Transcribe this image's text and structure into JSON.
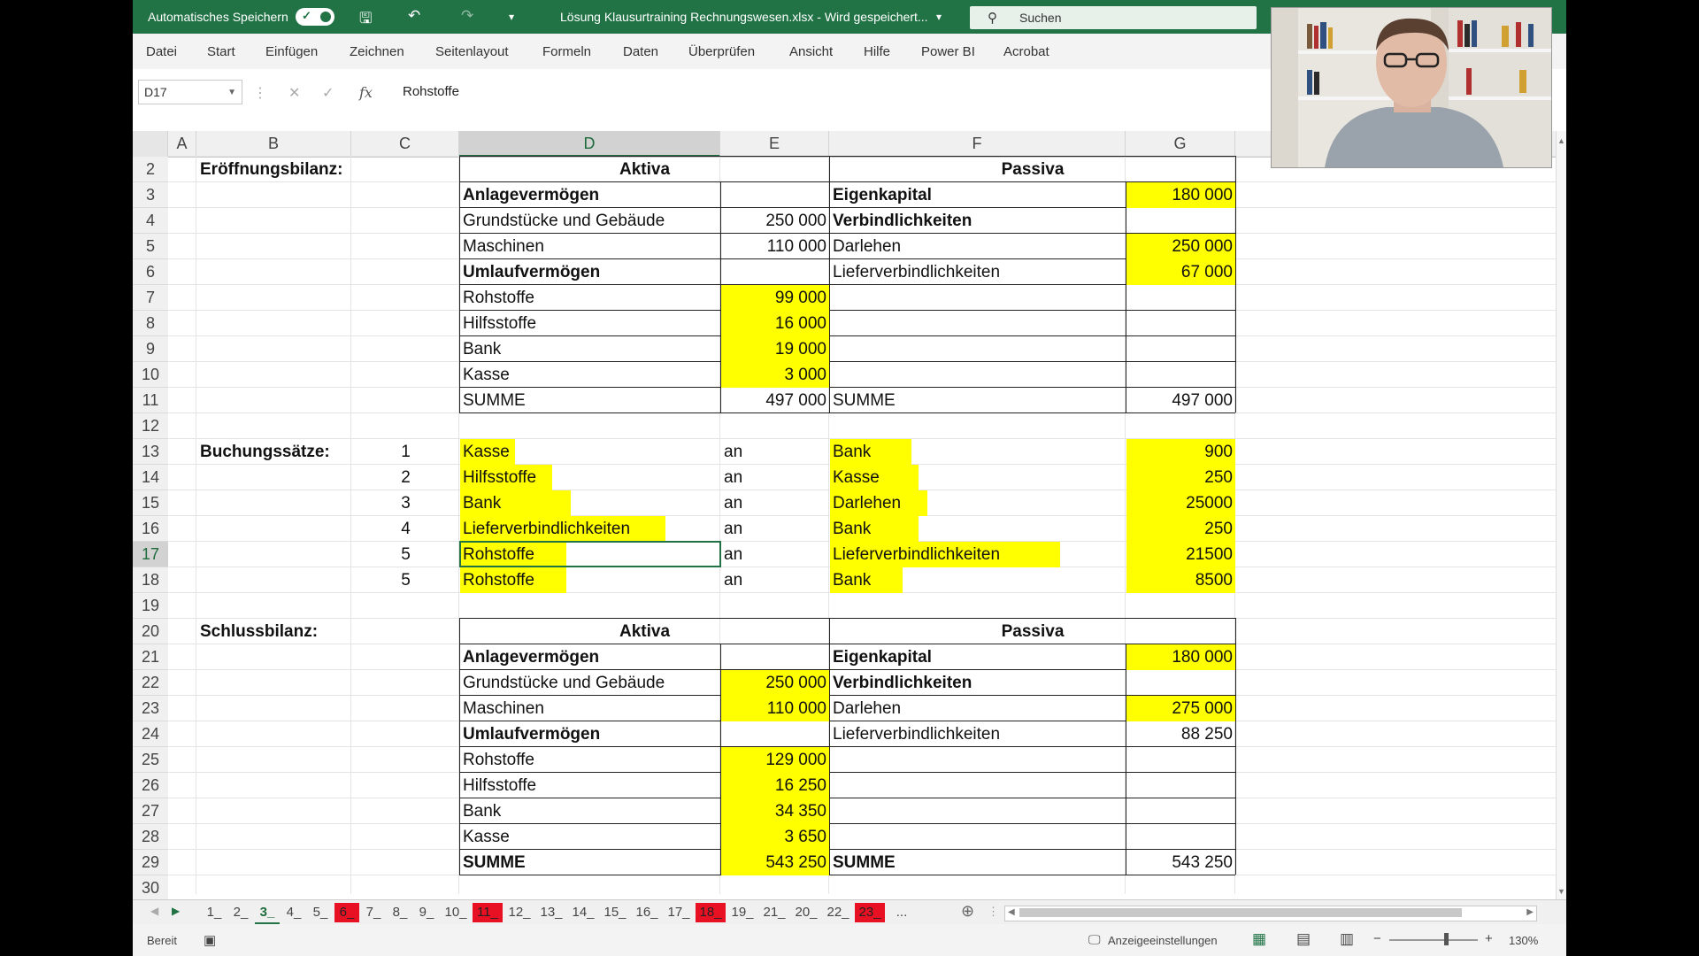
{
  "titlebar": {
    "autosave_label": "Automatisches Speichern",
    "filename": "Lösung Klausurtraining Rechnungswesen.xlsx  -  Wird gespeichert...",
    "search_placeholder": "Suchen"
  },
  "menu": [
    "Datei",
    "Start",
    "Einfügen",
    "Zeichnen",
    "Seitenlayout",
    "Formeln",
    "Daten",
    "Überprüfen",
    "Ansicht",
    "Hilfe",
    "Power BI",
    "Acrobat"
  ],
  "formula_bar": {
    "name_box": "D17",
    "fx": "fx",
    "content": "Rohstoffe"
  },
  "columns": [
    "A",
    "B",
    "C",
    "D",
    "E",
    "F",
    "G"
  ],
  "selected_column": "D",
  "rows": [
    "2",
    "3",
    "4",
    "5",
    "6",
    "7",
    "8",
    "9",
    "10",
    "11",
    "12",
    "13",
    "14",
    "15",
    "16",
    "17",
    "18",
    "19",
    "20",
    "21",
    "22",
    "23",
    "24",
    "25",
    "26",
    "27",
    "28",
    "29",
    "30"
  ],
  "selected_row": "17",
  "sheet": {
    "opening_label": "Eröffnungsbilanz:",
    "aktiva": "Aktiva",
    "passiva": "Passiva",
    "r3": {
      "d": "Anlagevermögen",
      "f": "Eigenkapital",
      "g": "180 000"
    },
    "r4": {
      "d": "Grundstücke und Gebäude",
      "e": "250 000",
      "f": "Verbindlichkeiten"
    },
    "r5": {
      "d": "Maschinen",
      "e": "110 000",
      "f": "Darlehen",
      "g": "250 000"
    },
    "r6": {
      "d": "Umlaufvermögen",
      "f": "Lieferverbindlichkeiten",
      "g": "67 000"
    },
    "r7": {
      "d": "Rohstoffe",
      "e": "99 000"
    },
    "r8": {
      "d": "Hilfsstoffe",
      "e": "16 000"
    },
    "r9": {
      "d": "Bank",
      "e": "19 000"
    },
    "r10": {
      "d": "Kasse",
      "e": "3 000"
    },
    "r11": {
      "d": "SUMME",
      "e": "497 000",
      "f": "SUMME",
      "g": "497 000"
    },
    "booking_label": "Buchungssätze:",
    "bookings": [
      {
        "no": "1",
        "debit": "Kasse",
        "an": "an",
        "credit": "Bank",
        "amount": "900"
      },
      {
        "no": "2",
        "debit": "Hilfsstoffe",
        "an": "an",
        "credit": "Kasse",
        "amount": "250"
      },
      {
        "no": "3",
        "debit": "Bank",
        "an": "an",
        "credit": "Darlehen",
        "amount": "25000"
      },
      {
        "no": "4",
        "debit": "Lieferverbindlichkeiten",
        "an": "an",
        "credit": "Bank",
        "amount": "250"
      },
      {
        "no": "5",
        "debit": "Rohstoffe",
        "an": "an",
        "credit": "Lieferverbindlichkeiten",
        "amount": "21500"
      },
      {
        "no": "5",
        "debit": "Rohstoffe",
        "an": "an",
        "credit": "Bank",
        "amount": "8500"
      }
    ],
    "closing_label": "Schlussbilanz:",
    "r21": {
      "d": "Anlagevermögen",
      "f": "Eigenkapital",
      "g": "180 000"
    },
    "r22": {
      "d": "Grundstücke und Gebäude",
      "e": "250 000",
      "f": "Verbindlichkeiten"
    },
    "r23": {
      "d": "Maschinen",
      "e": "110 000",
      "f": "Darlehen",
      "g": "275 000"
    },
    "r24": {
      "d": "Umlaufvermögen",
      "f": "Lieferverbindlichkeiten",
      "g": "88 250"
    },
    "r25": {
      "d": "Rohstoffe",
      "e": "129 000"
    },
    "r26": {
      "d": "Hilfsstoffe",
      "e": "16 250"
    },
    "r27": {
      "d": "Bank",
      "e": "34 350"
    },
    "r28": {
      "d": "Kasse",
      "e": "3 650"
    },
    "r29": {
      "d": "SUMME",
      "e": "543 250",
      "f": "SUMME",
      "g": "543 250"
    }
  },
  "tabs": [
    {
      "label": "1_",
      "red": false
    },
    {
      "label": "2_",
      "red": false
    },
    {
      "label": "3_",
      "red": false,
      "active": true
    },
    {
      "label": "4_",
      "red": false
    },
    {
      "label": "5_",
      "red": false
    },
    {
      "label": "6_",
      "red": true
    },
    {
      "label": "7_",
      "red": false
    },
    {
      "label": "8_",
      "red": false
    },
    {
      "label": "9_",
      "red": false
    },
    {
      "label": "10_",
      "red": false
    },
    {
      "label": "11_",
      "red": true
    },
    {
      "label": "12_",
      "red": false
    },
    {
      "label": "13_",
      "red": false
    },
    {
      "label": "14_",
      "red": false
    },
    {
      "label": "15_",
      "red": false
    },
    {
      "label": "16_",
      "red": false
    },
    {
      "label": "17_",
      "red": false
    },
    {
      "label": "18_",
      "red": true
    },
    {
      "label": "19_",
      "red": false
    },
    {
      "label": "21_",
      "red": false
    },
    {
      "label": "20_",
      "red": false
    },
    {
      "label": "22_",
      "red": false
    },
    {
      "label": "23_",
      "red": true
    },
    {
      "label": "...",
      "red": false
    }
  ],
  "status": {
    "ready": "Bereit",
    "display_settings": "Anzeigeeinstellungen",
    "zoom": "130%"
  },
  "colors": {
    "excel_green": "#217346",
    "highlight": "#ffff00",
    "tab_red": "#e81123"
  }
}
